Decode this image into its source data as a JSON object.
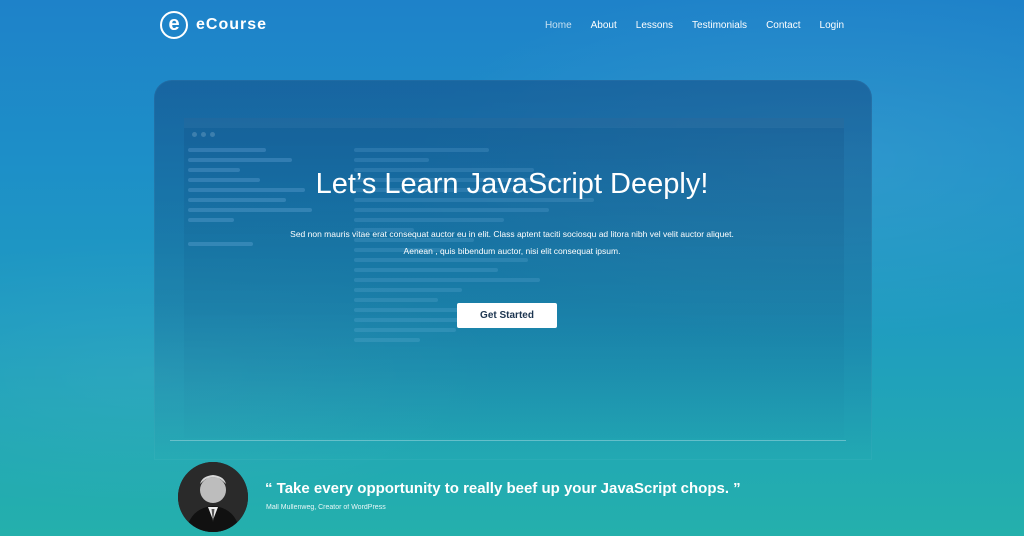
{
  "header": {
    "logo_letter": "e",
    "brand": "eCourse",
    "nav": [
      "Home",
      "About",
      "Lessons",
      "Testimonials",
      "Contact",
      "Login"
    ]
  },
  "hero": {
    "title": "Let’s Learn JavaScript Deeply!",
    "subtitle_line1": "Sed non mauris vitae erat consequat auctor eu in elit. Class aptent taciti sociosqu ad litora nibh vel velit auctor aliquet.",
    "subtitle_line2": "Aenean , quis bibendum auctor, nisi elit consequat ipsum.",
    "cta_label": "Get Started"
  },
  "testimonial": {
    "quote": "“ Take every opportunity to really beef up your JavaScript chops. ”",
    "author": "Mall Mullenweg, Creator of WordPress"
  },
  "colors": {
    "gradient_top": "#1e82c9",
    "gradient_bottom": "#24b0ac",
    "button_bg": "#ffffff",
    "button_text": "#1c3550"
  }
}
